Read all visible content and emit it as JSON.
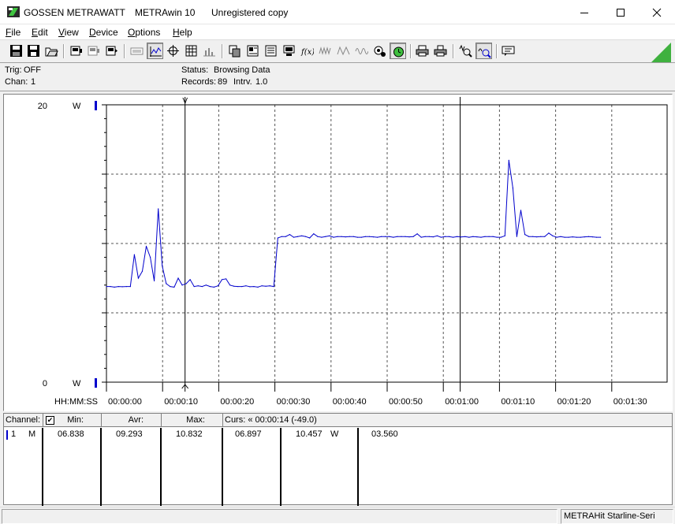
{
  "window": {
    "company": "GOSSEN METRAWATT",
    "app": "METRAwin 10",
    "license": "Unregistered copy",
    "controls": [
      "minimize-icon",
      "maximize-icon",
      "close-icon"
    ]
  },
  "menu": [
    "File",
    "Edit",
    "View",
    "Device",
    "Options",
    "Help"
  ],
  "toolbar_icons": [
    "save-icon",
    "save-as-icon",
    "open-icon",
    "device-1-icon",
    "device-2-icon",
    "device-3-icon",
    "keyboard-icon",
    "cursor-mode-icon",
    "crosshair-icon",
    "table-icon",
    "histogram-icon",
    "copy-icon",
    "export-icon",
    "statistics-icon",
    "computer-icon",
    "formula-icon",
    "waveform-1-icon",
    "waveform-2-icon",
    "waveform-3-icon",
    "settings-icon",
    "clock-icon",
    "print-icon",
    "print-preview-icon",
    "zoom-in-icon",
    "zoom-out-icon",
    "comment-icon"
  ],
  "status": {
    "trig_label": "Trig:",
    "trig_value": "OFF",
    "chan_label": "Chan:",
    "chan_value": "1",
    "status_label": "Status:",
    "status_value": "Browsing Data",
    "records_label": "Records:",
    "records_value": "89",
    "intrv_label": "Intrv.",
    "intrv_value": "1.0"
  },
  "plot": {
    "y_top_label": "20",
    "y_bottom_label": "0",
    "y_unit": "W",
    "x_axis_label": "HH:MM:SS",
    "cursor_marker": "V",
    "colors": {
      "trace": "#0000cc",
      "cursor": "#000000",
      "grid": "#000000"
    }
  },
  "chart_data": {
    "type": "line",
    "series": [
      {
        "values": [
          6.9,
          6.9,
          6.85,
          6.9,
          6.88,
          6.9,
          6.9,
          9.2,
          7.5,
          8.0,
          9.8,
          9.0,
          7.3,
          12.5,
          8.4,
          7.1,
          6.9,
          6.85,
          7.5,
          7.0,
          7.1,
          7.4,
          6.9,
          6.95,
          6.9,
          7.0,
          6.9,
          6.85,
          6.95,
          7.4,
          7.45,
          7.0,
          6.92,
          6.9,
          6.9,
          6.95,
          6.88,
          6.9,
          6.85,
          6.95,
          6.92,
          6.95,
          6.9,
          10.4,
          10.5,
          10.5,
          10.65,
          10.45,
          10.5,
          10.55,
          10.5,
          10.4,
          10.7,
          10.5,
          10.45,
          10.5,
          10.55,
          10.45,
          10.5,
          10.5,
          10.48,
          10.5,
          10.5,
          10.45,
          10.45,
          10.5,
          10.5,
          10.48,
          10.45,
          10.5,
          10.5,
          10.5,
          10.45,
          10.5,
          10.5,
          10.5,
          10.48,
          10.5,
          10.7,
          10.45,
          10.5,
          10.5,
          10.48,
          10.55,
          10.45,
          10.5,
          10.5,
          10.45,
          10.5,
          10.47,
          10.5,
          10.45,
          10.5,
          10.48,
          10.45,
          10.5,
          10.5,
          10.5,
          10.45,
          10.45,
          10.55,
          16.0,
          14.0,
          10.5,
          12.4,
          10.65,
          10.5,
          10.5,
          10.48,
          10.5,
          10.5,
          10.75,
          10.55,
          10.45,
          10.5,
          10.45,
          10.45,
          10.48,
          10.45,
          10.45,
          10.48,
          10.5,
          10.48,
          10.45,
          10.45
        ]
      }
    ],
    "ylim": [
      0,
      20
    ],
    "ytick_labels": [
      "20",
      "0"
    ],
    "ylabel": "W",
    "xlabel": "HH:MM:SS",
    "xtick_labels": [
      "00:00:00",
      "00:00:10",
      "00:00:20",
      "00:00:30",
      "00:00:40",
      "00:00:50",
      "00:01:00",
      "00:01:10",
      "00:01:20",
      "00:01:30"
    ],
    "xlim_seconds": [
      0,
      95
    ],
    "grid": true,
    "cursors_seconds": [
      14,
      63
    ]
  },
  "table": {
    "headers": {
      "channel": "Channel:",
      "checkbox": "✔",
      "min": "Min:",
      "avr": "Avr:",
      "max": "Max:",
      "curs": "Curs: « 00:00:14 (-49.0)"
    },
    "rows": [
      {
        "channel": "1",
        "mode": "M",
        "min": "06.838",
        "avr": "09.293",
        "max": "10.832",
        "curs_value": "06.897",
        "curs2_value": "10.457",
        "unit": "W",
        "delta": "03.560"
      }
    ],
    "colors": {
      "channel_marker": "#0000cc"
    }
  },
  "bottom_status": {
    "device": "METRAHit Starline-Seri"
  }
}
